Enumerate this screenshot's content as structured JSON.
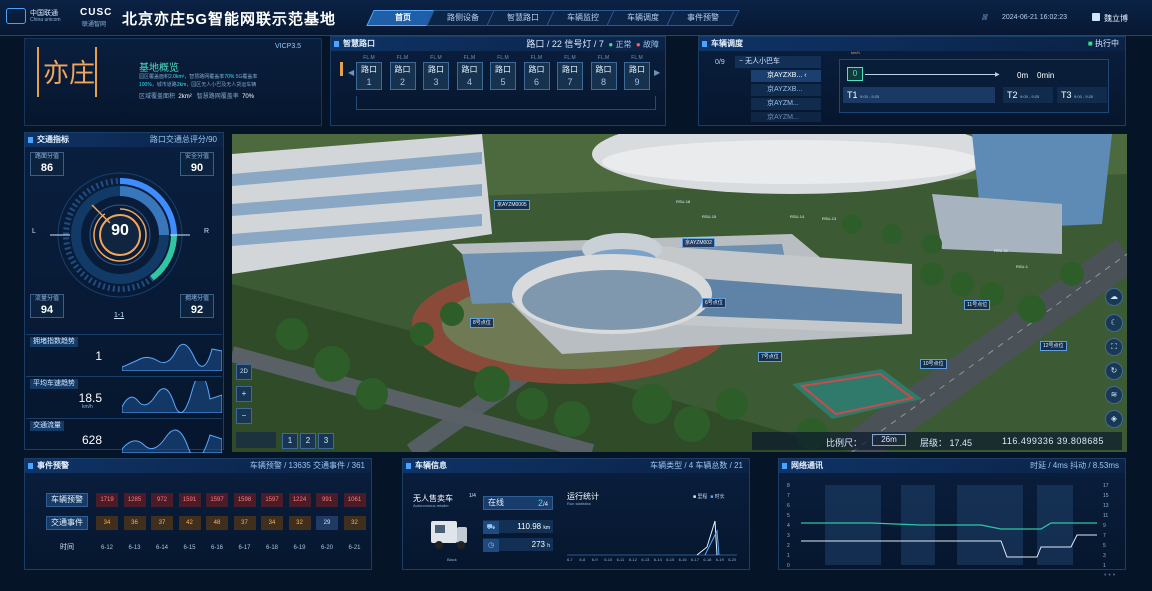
{
  "header": {
    "logo1_title": "中国联通",
    "logo1_sub": "China unicom",
    "logo2_title": "CUSC",
    "logo2_sub": "联通智网",
    "title": "北京亦庄5G智能网联示范基地",
    "datetime": "2024-06-21 16:02:23",
    "user": "魏立博",
    "nav": [
      "首页",
      "路侧设备",
      "智慧路口",
      "车辆监控",
      "车辆调度",
      "事件预警"
    ]
  },
  "overview": {
    "logo_text": "亦庄",
    "version": "VICP3.5",
    "title": "基地概览",
    "line1a": "园区覆盖面积",
    "line1b": "2.0km²",
    "line1c": "，智慧路网覆盖率",
    "line1d": "70%",
    "line1e": " 5G覆盖率",
    "line2a": "100%",
    "line2b": "，城市道路",
    "line2c": "2km",
    "line2d": "，园区无人小巴及无人货运车辆",
    "line3a": "区域覆盖面积",
    "line3b": "2km²",
    "line3c": "智慧路网覆盖率",
    "line3d": "70%"
  },
  "junction": {
    "title": "智慧路口",
    "stat": "路口 / 22  信号灯 / 7",
    "normal": "正常",
    "fault": "故障",
    "items": [
      {
        "label": "路口",
        "num": "1",
        "tag": "FL.M"
      },
      {
        "label": "路口",
        "num": "2",
        "tag": "FL.M"
      },
      {
        "label": "路口",
        "num": "3",
        "tag": "FL.M"
      },
      {
        "label": "路口",
        "num": "4",
        "tag": "FL.M"
      },
      {
        "label": "路口",
        "num": "5",
        "tag": "FL.M"
      },
      {
        "label": "路口",
        "num": "6",
        "tag": "FL.M"
      },
      {
        "label": "路口",
        "num": "7",
        "tag": "FL.M"
      },
      {
        "label": "路口",
        "num": "8",
        "tag": "FL.M"
      },
      {
        "label": "路口",
        "num": "9",
        "tag": "FL.M"
      }
    ]
  },
  "dispatch": {
    "title": "车辆调度",
    "status": "执行中",
    "count": "0/9",
    "group": "无人小巴车",
    "vehicles": [
      "京AYZXB...",
      "京AYZXB...",
      "京AYZM...",
      "京AYZM..."
    ],
    "speed": "0",
    "speed_unit": "km/h",
    "dist": "0m",
    "time": "0min",
    "t1": "T1",
    "t2": "T2",
    "t3": "T3",
    "slot_text": "9:00 - 9:20"
  },
  "traffic": {
    "title": "交通指标",
    "stat": "路口交通总评分/90",
    "gauge_value": "90",
    "gauge_level": 0.9,
    "tl_label": "路面分值",
    "tl_value": "86",
    "tr_label": "安全分值",
    "tr_value": "90",
    "bl_label": "流量分值",
    "bl_value": "94",
    "br_label": "拥堵分值",
    "br_value": "92",
    "left_mark": "L",
    "right_mark": "R",
    "page": "1-1",
    "metrics": [
      {
        "label": "拥堵指数趋势",
        "value": "1",
        "unit": ""
      },
      {
        "label": "平均车速趋势",
        "value": "18.5",
        "unit": "km/h"
      },
      {
        "label": "交通流量",
        "value": "628",
        "unit": ""
      }
    ]
  },
  "events": {
    "title": "事件预警",
    "stat": "车辆预警 / 13635   交通事件 / 361",
    "row1_label": "车辆预警",
    "row1": [
      "1719",
      "1285",
      "972",
      "1591",
      "1597",
      "1598",
      "1597",
      "1224",
      "991",
      "1061"
    ],
    "row2_label": "交通事件",
    "row2": [
      "34",
      "36",
      "37",
      "42",
      "48",
      "37",
      "34",
      "32",
      "29",
      "32"
    ],
    "row3_label": "时间",
    "dates": [
      "6-12",
      "6-13",
      "6-14",
      "6-15",
      "6-16",
      "6-17",
      "6-18",
      "6-19",
      "6-20",
      "6-21"
    ]
  },
  "vehicle_info": {
    "title": "车辆信息",
    "stat": "车辆类型 / 4   车辆总数 / 21",
    "name": "无人售卖车",
    "name_en": "Autonomous retailer",
    "page": "1/4",
    "online_label": "在线",
    "online_value": "2",
    "online_total": "/4",
    "mileage": "110.98",
    "mileage_unit": "km",
    "hours": "273",
    "hours_unit": "h",
    "brand": "Black",
    "chart_title": "运行统计",
    "chart_sub": "Run statistics",
    "legend1": "里程",
    "legend2": "时长",
    "dates": [
      "6-7",
      "6-8",
      "6-9",
      "6-10",
      "6-11",
      "6-12",
      "6-13",
      "6-14",
      "6-15",
      "6-16",
      "6-17",
      "6-18",
      "6-19",
      "6-20"
    ]
  },
  "network": {
    "title": "网络通讯",
    "stat": "时延 / 4ms   抖动 / 8.53ms",
    "left_axis": [
      "8",
      "7",
      "6",
      "5",
      "4",
      "3",
      "2",
      "1",
      "0"
    ],
    "right_axis": [
      "17",
      "15",
      "13",
      "11",
      "9",
      "7",
      "5",
      "3",
      "1"
    ]
  },
  "map": {
    "mode_2d": "2D",
    "zoom_in": "+",
    "zoom_out": "−",
    "pages": [
      "1",
      "2",
      "3"
    ],
    "scale_label": "比例尺：",
    "scale_value": "26m",
    "level_label": "层级：",
    "level_value": "17.45",
    "coords": "116.499336 39.808685",
    "tags": [
      "京AYZM0005",
      "京AYZM002",
      "6号点位",
      "8号点位",
      "7号点位",
      "10号点位",
      "11号点位",
      "12号点位"
    ],
    "poles": [
      "RSU-18",
      "RSU-15",
      "RSU-14",
      "RSU-13",
      "RSU-11",
      "RSU-1"
    ]
  }
}
